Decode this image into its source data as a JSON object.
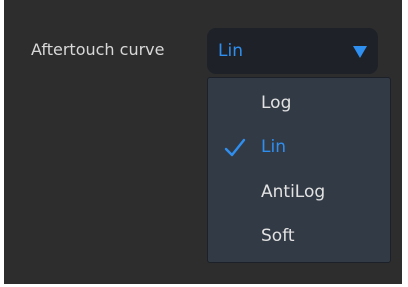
{
  "setting": {
    "label": "Aftertouch curve"
  },
  "dropdown": {
    "selected_value": "Lin",
    "accent_color": "#2f8ff0",
    "arrow_icon": "triangle-down-icon",
    "options": [
      {
        "label": "Log",
        "selected": false
      },
      {
        "label": "Lin",
        "selected": true
      },
      {
        "label": "AntiLog",
        "selected": false
      },
      {
        "label": "Soft",
        "selected": false
      }
    ],
    "check_icon": "checkmark-icon"
  }
}
